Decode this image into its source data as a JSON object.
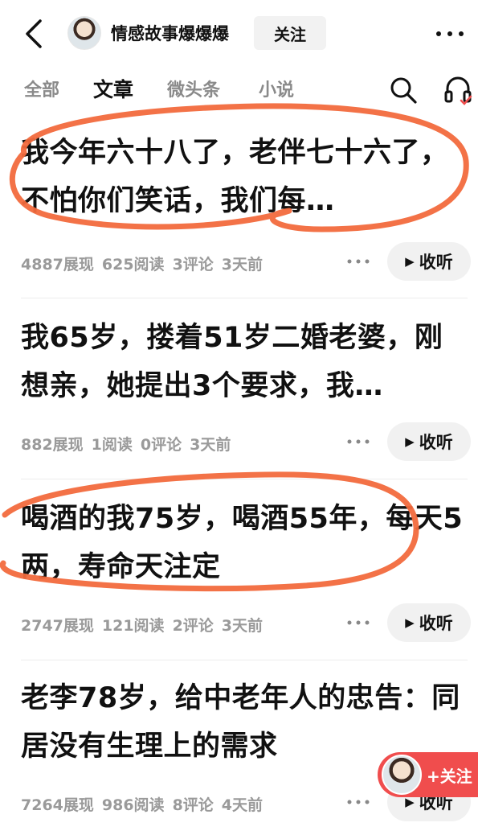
{
  "header": {
    "channel_name": "情感故事爆爆爆",
    "follow_label": "关注",
    "back_icon": "back-arrow-icon",
    "more_icon": "more-dots-icon"
  },
  "tabs": [
    {
      "label": "全部",
      "active": false
    },
    {
      "label": "文章",
      "active": true
    },
    {
      "label": "微头条",
      "active": false
    },
    {
      "label": "小说",
      "active": false
    }
  ],
  "articles": [
    {
      "title": "我今年六十八了，老伴七十六了，不怕你们笑话，我们每…",
      "views": "4887展现",
      "reads": "625阅读",
      "comments": "3评论",
      "time": "3天前",
      "listen_label": "收听"
    },
    {
      "title": "我65岁，搂着51岁二婚老婆，刚想亲，她提出3个要求，我…",
      "views": "882展现",
      "reads": "1阅读",
      "comments": "0评论",
      "time": "3天前",
      "listen_label": "收听"
    },
    {
      "title": "喝酒的我75岁，喝酒55年，每天5两，寿命天注定",
      "views": "2747展现",
      "reads": "121阅读",
      "comments": "2评论",
      "time": "3天前",
      "listen_label": "收听"
    },
    {
      "title": "老李78岁，给中老年人的忠告：同居没有生理上的需求",
      "views": "7264展现",
      "reads": "986阅读",
      "comments": "8评论",
      "time": "4天前",
      "listen_label": "收听"
    }
  ],
  "floating_follow": {
    "label": "+关注"
  },
  "colors": {
    "accent": "#f04d4d",
    "annotation": "#f26a3d",
    "meta": "#9a9a9a"
  }
}
